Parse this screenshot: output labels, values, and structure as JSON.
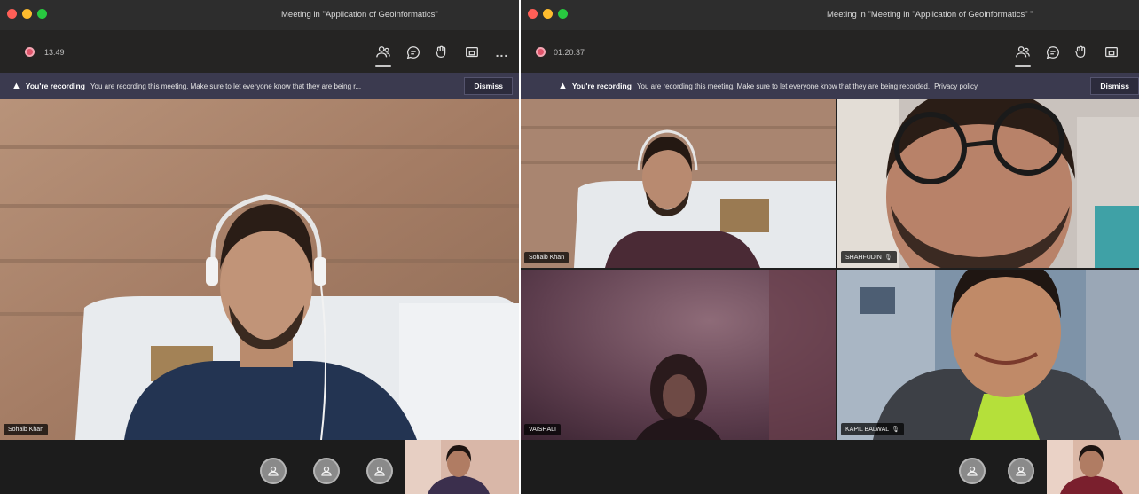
{
  "window1": {
    "title": "Meeting in \"Application of Geoinformatics\"",
    "timer": "13:49",
    "banner": {
      "title": "You're recording",
      "message": "You are recording this meeting. Make sure to let everyone know that they are being r...",
      "dismiss": "Dismiss"
    },
    "participants": [
      {
        "name": "Sohaib Khan"
      }
    ],
    "icons": [
      "people-icon",
      "chat-icon",
      "react-icon",
      "share-icon",
      "more-icon"
    ],
    "more_label": "..."
  },
  "window2": {
    "title": "Meeting in \"Meeting in \"Application of Geoinformatics\" \"",
    "timer": "01:20:37",
    "banner": {
      "title": "You're recording",
      "message": "You are recording this meeting. Make sure to let everyone know that they are being recorded.",
      "link": "Privacy policy",
      "dismiss": "Dismiss"
    },
    "participants": [
      {
        "name": "Sohaib Khan"
      },
      {
        "name": "SHAHFUDIN"
      },
      {
        "name": "VAISHALI"
      },
      {
        "name": "KAPIL BALWAL"
      }
    ],
    "icons": [
      "people-icon",
      "chat-icon",
      "react-icon",
      "share-icon"
    ]
  },
  "colors": {
    "recording": "#e0556b",
    "banner_bg": "#3b3a4f",
    "chrome_bg": "#252423"
  }
}
